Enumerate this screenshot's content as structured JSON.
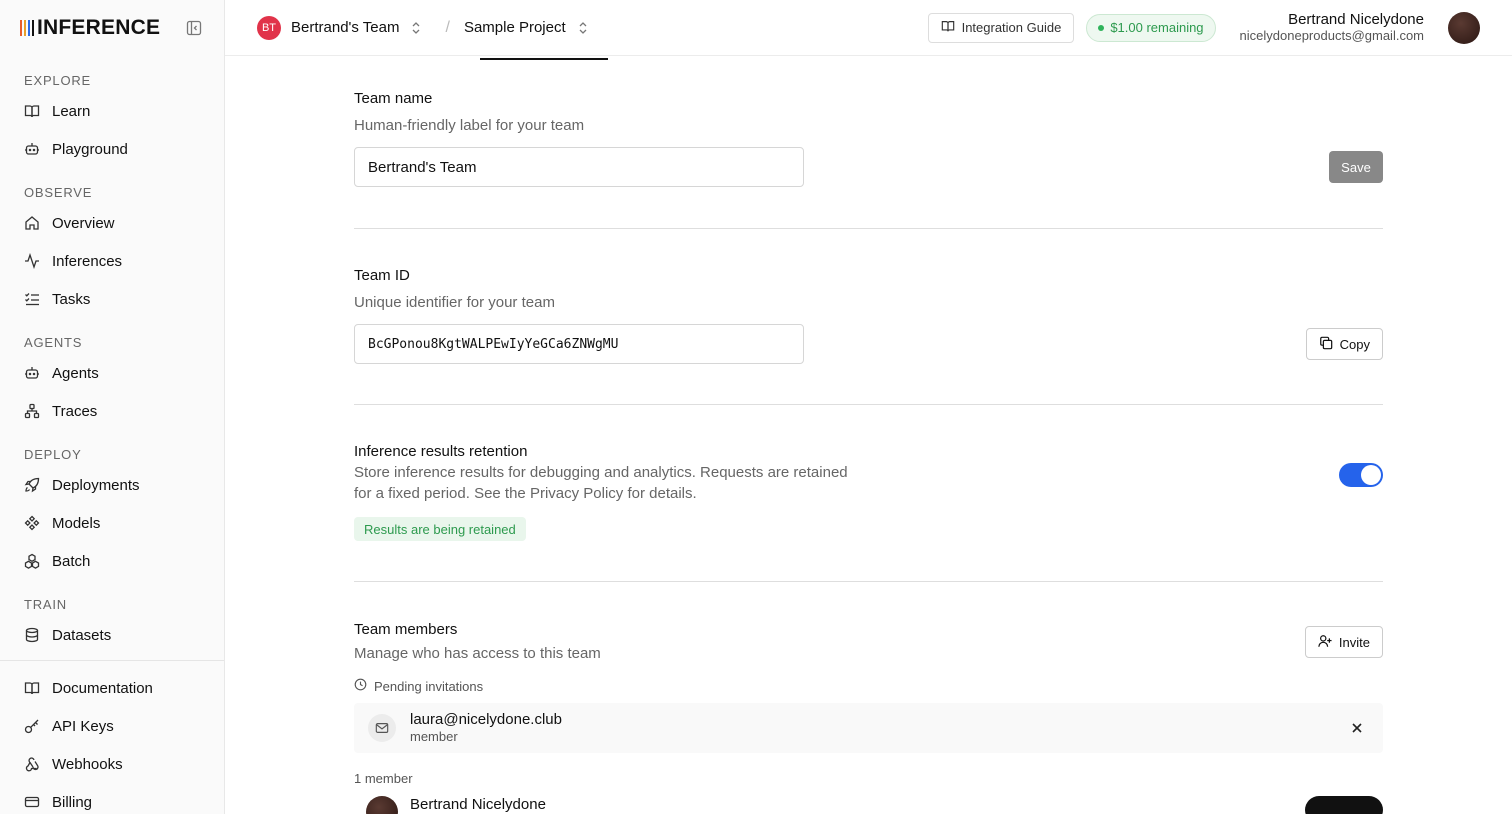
{
  "brand": {
    "name": "INFERENCE",
    "bar_colors": [
      "#e85d2c",
      "#e8a02c",
      "#2c6be8",
      "#111111"
    ]
  },
  "sidebar": {
    "sections": [
      {
        "label": "EXPLORE",
        "items": [
          {
            "label": "Learn",
            "icon": "book-icon"
          },
          {
            "label": "Playground",
            "icon": "bot-icon"
          }
        ]
      },
      {
        "label": "OBSERVE",
        "items": [
          {
            "label": "Overview",
            "icon": "home-icon"
          },
          {
            "label": "Inferences",
            "icon": "activity-icon"
          },
          {
            "label": "Tasks",
            "icon": "list-check-icon"
          }
        ]
      },
      {
        "label": "AGENTS",
        "items": [
          {
            "label": "Agents",
            "icon": "bot-icon"
          },
          {
            "label": "Traces",
            "icon": "network-icon"
          }
        ]
      },
      {
        "label": "DEPLOY",
        "items": [
          {
            "label": "Deployments",
            "icon": "rocket-icon"
          },
          {
            "label": "Models",
            "icon": "component-icon"
          },
          {
            "label": "Batch",
            "icon": "boxes-icon"
          }
        ]
      },
      {
        "label": "TRAIN",
        "items": [
          {
            "label": "Datasets",
            "icon": "database-icon"
          }
        ]
      }
    ],
    "bottom_items": [
      {
        "label": "Documentation",
        "icon": "book-icon"
      },
      {
        "label": "API Keys",
        "icon": "key-icon"
      },
      {
        "label": "Webhooks",
        "icon": "webhook-icon"
      },
      {
        "label": "Billing",
        "icon": "credit-card-icon"
      }
    ]
  },
  "header": {
    "team_initials": "BT",
    "team_name": "Bertrand's Team",
    "separator": "/",
    "project_name": "Sample Project",
    "guide_label": "Integration Guide",
    "credit_label": "$1.00 remaining",
    "user_name": "Bertrand Nicelydone",
    "user_email": "nicelydoneproducts@gmail.com"
  },
  "settings": {
    "team_name": {
      "title": "Team name",
      "description": "Human-friendly label for your team",
      "value": "Bertrand's Team",
      "save_label": "Save"
    },
    "team_id": {
      "title": "Team ID",
      "description": "Unique identifier for your team",
      "value": "BcGPonou8KgtWALPEwIyYeGCa6ZNWgMU",
      "copy_label": "Copy"
    },
    "retention": {
      "title": "Inference results retention",
      "description_line1": "Store inference results for debugging and analytics. Requests are retained",
      "description_line2": "for a fixed period. See the Privacy Policy for details.",
      "enabled": true,
      "status_badge": "Results are being retained"
    },
    "members": {
      "title": "Team members",
      "description": "Manage who has access to this team",
      "invite_label": "Invite",
      "pending_label": "Pending invitations",
      "pending": [
        {
          "email": "laura@nicelydone.club",
          "role": "member"
        }
      ],
      "count_label": "1 member",
      "members": [
        {
          "name": "Bertrand Nicelydone"
        }
      ]
    }
  },
  "colors": {
    "accent": "#2563eb",
    "success": "#2d9a4e",
    "danger_avatar": "#e1334a"
  }
}
